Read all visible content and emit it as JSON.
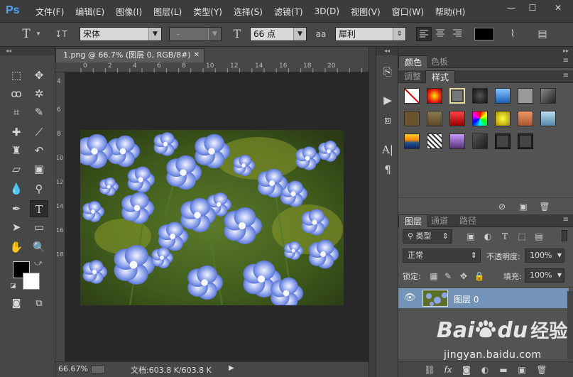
{
  "app": {
    "logo": "Ps"
  },
  "menu": [
    "文件(F)",
    "编辑(E)",
    "图像(I)",
    "图层(L)",
    "类型(Y)",
    "选择(S)",
    "滤镜(T)",
    "3D(D)",
    "视图(V)",
    "窗口(W)",
    "帮助(H)"
  ],
  "window_controls": [
    "—",
    "☐",
    "✕"
  ],
  "options": {
    "type_tool_icon": "T",
    "type_dropdown_arrow": "▾",
    "orient_icon": "↧T",
    "font_family": "宋体",
    "font_style": "-",
    "size_icon": "T",
    "font_size": "66 点",
    "aa_icon": "aa",
    "antialias": "犀利",
    "text_color": "#000000"
  },
  "document": {
    "tab_title": "1.png @ 66.7% (图层 0, RGB/8#)",
    "tab_close": "✕",
    "ruler_h": [
      "0",
      "2",
      "4",
      "6",
      "8",
      "10",
      "12",
      "14",
      "16",
      "18",
      "20"
    ],
    "ruler_v": [
      "4",
      "6",
      "8",
      "10",
      "12",
      "14",
      "16",
      "18"
    ],
    "zoom": "66.67%",
    "doc_info": "文档:603.8 K/603.8 K"
  },
  "panels": {
    "top_tabs": [
      "颜色",
      "色板"
    ],
    "style_tabs": [
      "调整",
      "样式"
    ],
    "layers_tabs": [
      "图层",
      "通道",
      "路径"
    ],
    "filter_kind": "类型",
    "blend_mode": "正常",
    "opacity_label": "不透明度:",
    "opacity": "100%",
    "lock_label": "锁定:",
    "fill_label": "填充:",
    "fill": "100%",
    "layer_name": "图层 0"
  },
  "watermark": {
    "brand": "Bai",
    "brand2": "du",
    "text": "经验",
    "url": "jingyan.baidu.com"
  },
  "colors": {
    "accent": "#4aa3ff",
    "layer_selected": "#7393b8"
  }
}
